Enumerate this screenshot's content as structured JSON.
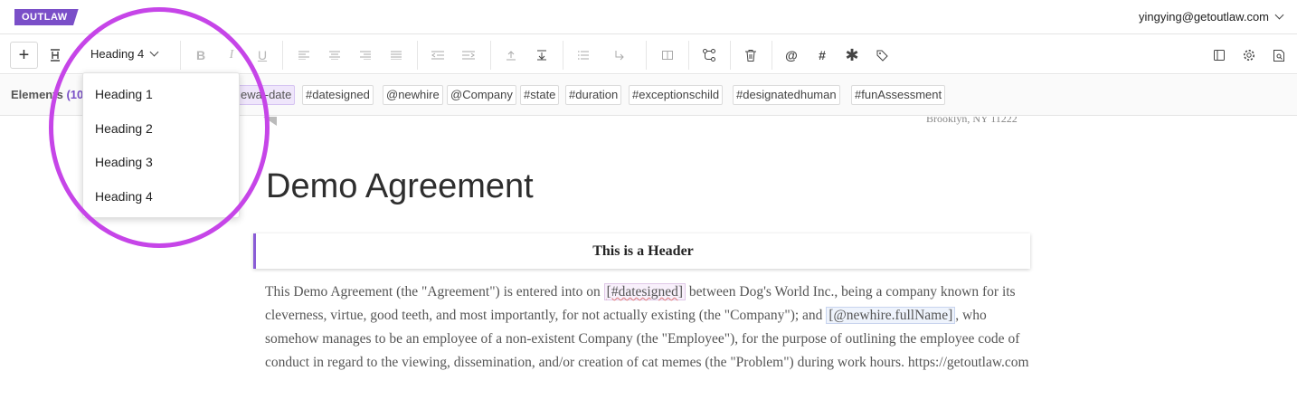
{
  "app": {
    "logo": "OUTLAW",
    "user_email": "yingying@getoutlaw.com"
  },
  "toolbar": {
    "style_value": "Heading 4"
  },
  "elements": {
    "label": "Elements",
    "count": "(10",
    "chips": [
      "ewal-date",
      "#datesigned",
      "@newhire",
      "@Company",
      "#state",
      "#duration",
      "#exceptionschild",
      "#designatedhuman",
      "#funAssessment"
    ]
  },
  "dropdown": {
    "options": [
      "Heading 1",
      "Heading 2",
      "Heading 3",
      "Heading 4"
    ]
  },
  "document": {
    "address": "Brooklyn, NY 11222",
    "title": "Demo Agreement",
    "header": "This is a Header",
    "body": {
      "t1": "This Demo Agreement (the \"Agreement\") is entered into on ",
      "var1": "[#datesigned]",
      "t2": " between Dog's World Inc., being a company known for its cleverness, virtue, good teeth, and most importantly, for not actually existing (the \"Company\"); and ",
      "var2": "[@newhire.fullName]",
      "t3": ", who somehow manages to be an employee of a non-existent Company (the \"Employee\"), for the purpose of outlining the employee code of conduct in regard to the viewing, dissemination, and/or creation of cat memes (the \"Problem\") during work hours. https://getoutlaw.com"
    }
  },
  "colors": {
    "brand": "#7a4fc8",
    "highlight_circle": "#c645e8",
    "header_accent": "#8a5cd6"
  },
  "icons": [
    "plus-icon",
    "heading-style-icon",
    "chevron-down-icon",
    "bold-icon",
    "italic-icon",
    "underline-icon",
    "align-left-icon",
    "align-center-icon",
    "align-right-icon",
    "align-justify-icon",
    "outdent-icon",
    "indent-icon",
    "move-up-icon",
    "move-down-icon",
    "list-icon",
    "return-arrow-icon",
    "columns-icon",
    "workflow-icon",
    "trash-icon",
    "at-icon",
    "hash-icon",
    "asterisk-icon",
    "tag-icon",
    "panel-icon",
    "settings-icon",
    "preview-icon"
  ]
}
